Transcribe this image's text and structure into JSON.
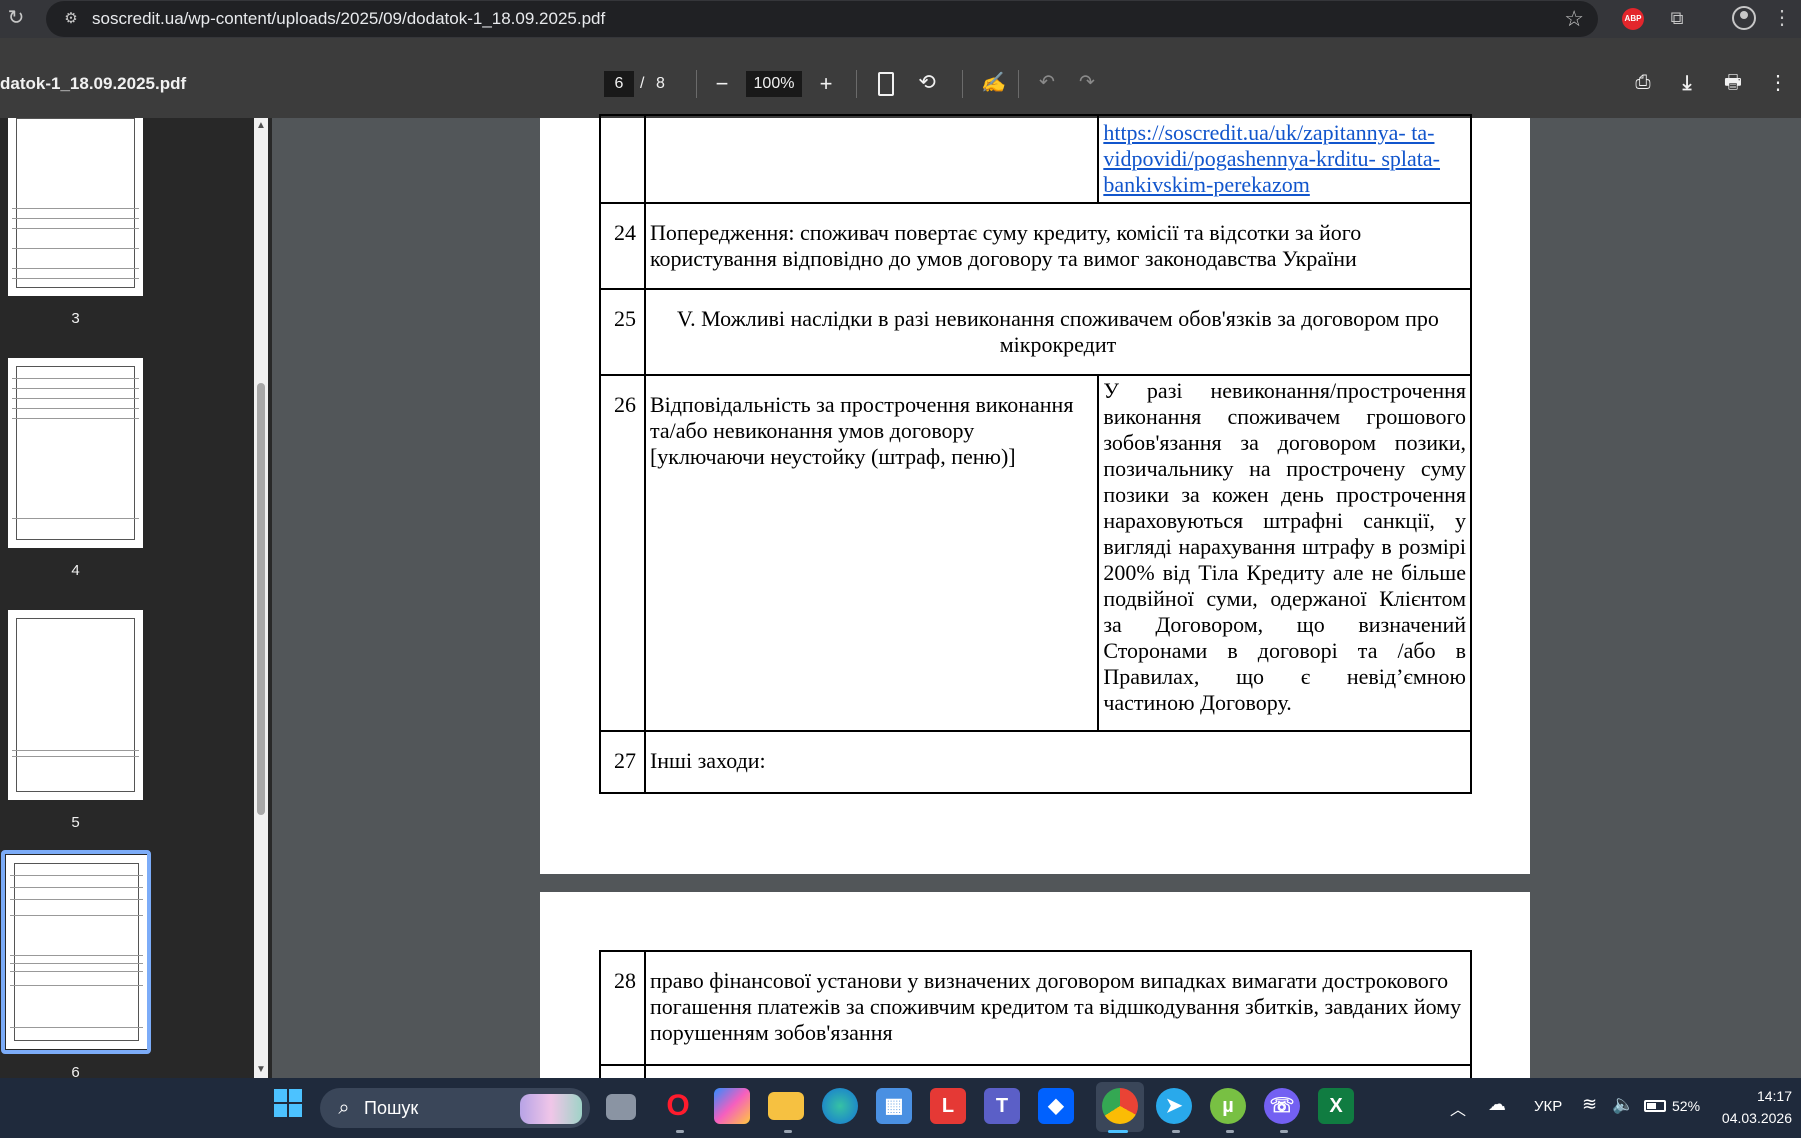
{
  "browser": {
    "url": "soscredit.ua/wp-content/uploads/2025/09/dodatok-1_18.09.2025.pdf",
    "extension_badge": "ABP"
  },
  "viewer": {
    "title": "datok-1_18.09.2025.pdf",
    "current_page": "6",
    "page_separator": "/",
    "total_pages": "8",
    "zoom": "100%"
  },
  "sidebar": {
    "thumbnails": [
      {
        "label": "3"
      },
      {
        "label": "4"
      },
      {
        "label": "5"
      },
      {
        "label": "6",
        "selected": true
      }
    ]
  },
  "document": {
    "rows": [
      {
        "num": "",
        "left": "",
        "link_lines": [
          "https://soscredit.ua/uk/zapitannya- ta-",
          "vidpovidi/pogashennya-krditu- splata-",
          "bankivskim-perekazom"
        ]
      },
      {
        "num": "24",
        "text": "Попередження: споживач повертає суму кредиту, комісії та відсотки за його користування відповідно до умов договору та вимог законодавства України"
      },
      {
        "num": "25",
        "text": "V. Можливі наслідки в разі невиконання споживачем обов'язків за договором про мікрокредит"
      },
      {
        "num": "26",
        "left": "Відповідальність за прострочення виконання та/або невиконання умов договору [уключаючи неустойку (штраф, пеню)]",
        "right": "У разі невиконання/прострочення виконання споживачем грошового зобов'язання за договором позики, позичальнику на прострочену суму позики за кожен день прострочення нараховуються штрафні санкції, у вигляді нарахування штрафу в розмірі 200% від Тіла Кредиту але не більше подвійної суми, одержаної Клієнтом за Договором, що визначений Сторонами в договорі та /або в Правилах, що є невід’ємною частиною Договору."
      },
      {
        "num": "27",
        "text": "Інші заходи:"
      }
    ],
    "next_page_rows": [
      {
        "num": "28",
        "text": "право фінансової установи у визначених договором випадках вимагати дострокового погашення платежів за споживчим кредитом та відшкодування збитків, завданих йому порушенням зобов'язання"
      }
    ]
  },
  "taskbar": {
    "search_label": "Пошук",
    "apps": [
      "file-manager",
      "opera",
      "copilot",
      "file-explorer",
      "edge",
      "store",
      "lightshot",
      "teams",
      "dropbox",
      "chrome",
      "telegram",
      "utorrent",
      "viber",
      "excel"
    ],
    "language": "УКР",
    "battery": "52%",
    "time": "14:17",
    "date": "04.03.2026"
  }
}
